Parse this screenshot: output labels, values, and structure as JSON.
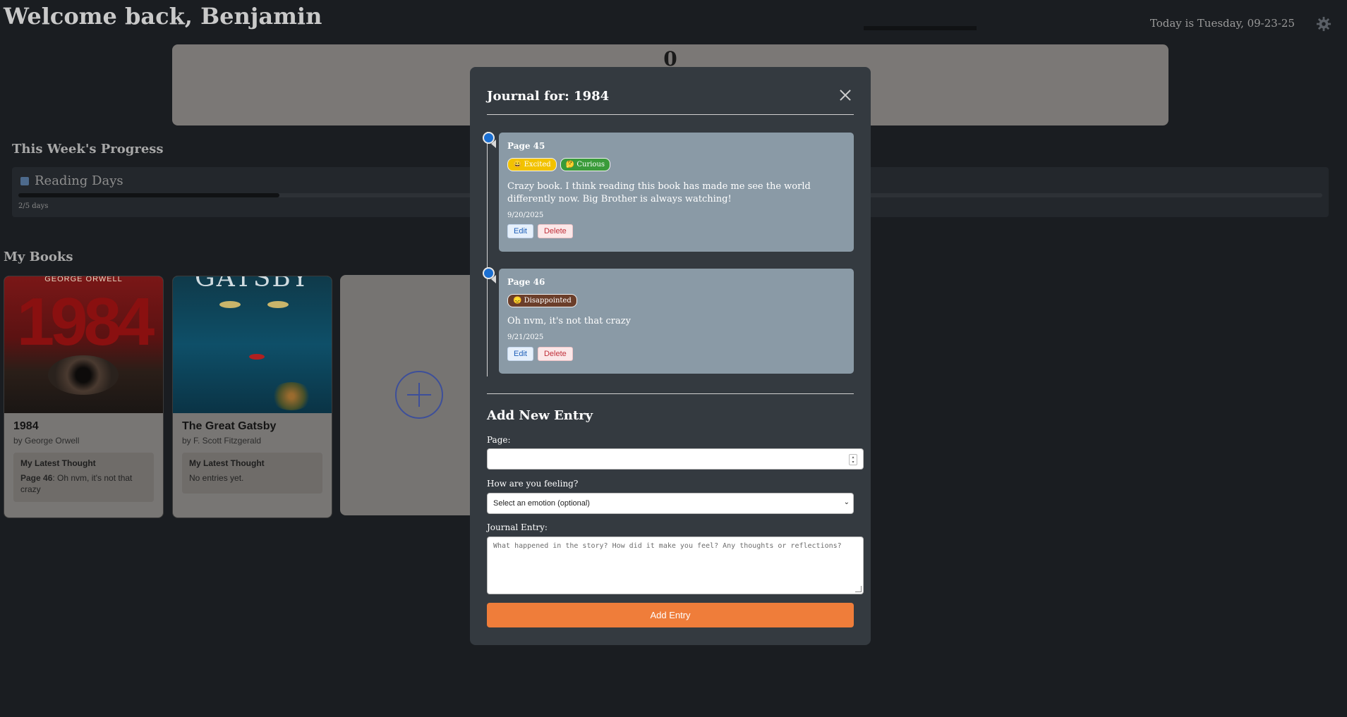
{
  "header": {
    "welcome": "Welcome back, Benjamin",
    "today": "Today is Tuesday, 09-23-25",
    "settings_icon": "gear-icon"
  },
  "counter": {
    "value": "0"
  },
  "progress": {
    "section_title": "This Week's Progress",
    "label": "Reading Days",
    "icon": "calendar-icon",
    "days_text": "2/5 days",
    "fraction": 0.4
  },
  "books": {
    "section_title": "My Books",
    "items": [
      {
        "title": "1984",
        "author": "by George Orwell",
        "cover_text": "1984",
        "cover_author": "GEORGE ORWELL",
        "thought_heading": "My Latest Thought",
        "thought_page": "Page 46",
        "thought_text": ": Oh nvm, it's not that crazy"
      },
      {
        "title": "The Great Gatsby",
        "author": "by F. Scott Fitzgerald",
        "cover_text": "GATSBY",
        "thought_heading": "My Latest Thought",
        "thought_text": "No entries yet."
      }
    ],
    "add_icon": "plus-circle-icon"
  },
  "modal": {
    "title": "Journal for: 1984",
    "entries": [
      {
        "page": "Page 45",
        "tags": [
          "😀 Excited",
          "🤔 Curious"
        ],
        "text": "Crazy book. I think reading this book has made me see the world differently now. Big Brother is always watching!",
        "date": "9/20/2025",
        "edit": "Edit",
        "delete": "Delete"
      },
      {
        "page": "Page 46",
        "tags": [
          "😞 Disappointed"
        ],
        "text": "Oh nvm, it's not that crazy",
        "date": "9/21/2025",
        "edit": "Edit",
        "delete": "Delete"
      }
    ],
    "add_title": "Add New Entry",
    "page_label": "Page:",
    "feeling_label": "How are you feeling?",
    "feeling_selected": "Select an emotion (optional)",
    "journal_label": "Journal Entry:",
    "journal_placeholder": "What happened in the story? How did it make you feel? Any thoughts or reflections?",
    "submit": "Add Entry"
  },
  "colors": {
    "accent_orange": "#ef7d3a",
    "timeline_dot": "#1b6fd1",
    "excited": "#f2c200",
    "curious": "#3a9b3a",
    "disappointed": "#6b3e2a"
  }
}
